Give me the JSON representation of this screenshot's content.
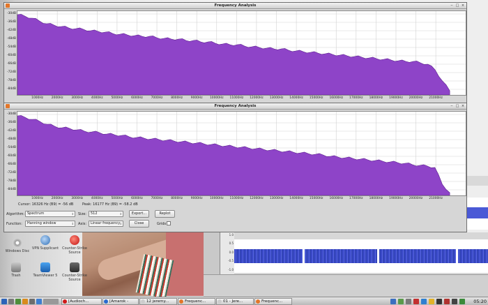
{
  "desktop": {
    "icons": [
      {
        "label": "Windows Disc",
        "icon": "disc-icon"
      },
      {
        "label": "VPN Supplicant",
        "icon": "globe-icon"
      },
      {
        "label": "Counter-Strike Source",
        "icon": "red-ball-icon"
      },
      {
        "label": "Trash",
        "icon": "trash-icon"
      },
      {
        "label": "TeamViewer 5",
        "icon": "teamviewer-icon"
      },
      {
        "label": "Counter-Strike Source",
        "icon": "cs-icon"
      }
    ]
  },
  "audio_editor": {
    "scale_labels": [
      "1.0",
      "0.5",
      "0.0",
      "-0.5",
      "-1.0"
    ]
  },
  "window_back": {
    "title": "Frequency Analysis",
    "y_ticks": [
      "-30dB",
      "-36dB",
      "-42dB",
      "-48dB",
      "-54dB",
      "-60dB",
      "-66dB",
      "-72dB",
      "-78dB",
      "-84dB"
    ],
    "x_ticks": [
      "1000Hz",
      "2000Hz",
      "3000Hz",
      "4000Hz",
      "5000Hz",
      "6000Hz",
      "7000Hz",
      "8000Hz",
      "9000Hz",
      "10000Hz",
      "11000Hz",
      "12000Hz",
      "13000Hz",
      "14000Hz",
      "15000Hz",
      "16000Hz",
      "17000Hz",
      "18000Hz",
      "19000Hz",
      "20000Hz",
      "21000Hz"
    ],
    "spectrum": [
      -30.5,
      -31.5,
      -33,
      -35,
      -37,
      -38,
      -39,
      -40,
      -40.5,
      -41,
      -42,
      -42.5,
      -43,
      -44,
      -44.5,
      -45,
      -45.5,
      -46,
      -46,
      -47,
      -47.5,
      -48,
      -48,
      -49,
      -49,
      -50,
      -50,
      -51,
      -51.5,
      -52,
      -52,
      -53,
      -53.5,
      -54,
      -54.5,
      -55,
      -55,
      -56,
      -56.5,
      -57,
      -57.5,
      -58,
      -58.5,
      -59,
      -59.5,
      -60,
      -60.5,
      -61,
      -61.5,
      -62,
      -62.5,
      -63,
      -63.5,
      -64,
      -64,
      -65,
      -66,
      -70,
      -78,
      -85
    ]
  },
  "window_front": {
    "title": "Frequency Analysis",
    "y_ticks": [
      "-30dB",
      "-36dB",
      "-42dB",
      "-48dB",
      "-54dB",
      "-60dB",
      "-66dB",
      "-72dB",
      "-78dB",
      "-84dB"
    ],
    "x_ticks": [
      "1000Hz",
      "2000Hz",
      "3000Hz",
      "4000Hz",
      "5000Hz",
      "6000Hz",
      "7000Hz",
      "8000Hz",
      "9000Hz",
      "10000Hz",
      "11000Hz",
      "12000Hz",
      "13000Hz",
      "14000Hz",
      "15000Hz",
      "16000Hz",
      "17000Hz",
      "18000Hz",
      "19000Hz",
      "20000Hz",
      "21000Hz"
    ],
    "spectrum": [
      -31,
      -32,
      -33.5,
      -35,
      -37,
      -38.5,
      -39.5,
      -40,
      -41,
      -42,
      -42.5,
      -43,
      -44,
      -44.5,
      -45,
      -46,
      -46.5,
      -47,
      -47.5,
      -48,
      -48.5,
      -49,
      -49.5,
      -50,
      -50.5,
      -51,
      -51.5,
      -52,
      -52.5,
      -53,
      -53.5,
      -54,
      -54.5,
      -55,
      -55.5,
      -56,
      -56.5,
      -57,
      -57.5,
      -58,
      -58.5,
      -59,
      -60,
      -60.5,
      -61,
      -61.5,
      -62,
      -62.5,
      -63,
      -63.5,
      -64,
      -64.5,
      -65,
      -66,
      -66.5,
      -67,
      -68,
      -80,
      -86
    ],
    "cursor_text": "Cursor: 16326 Hz (B9) = -56 dB",
    "peak_text": "Peak: 16177 Hz (B9) = -58.2 dB",
    "controls": {
      "algorithm_label": "Algorithm:",
      "algorithm_value": "Spectrum",
      "size_label": "Size:",
      "size_value": "512",
      "export_label": "Export...",
      "replot_label": "Replot",
      "function_label": "Function:",
      "function_value": "Hanning window",
      "axis_label": "Axis:",
      "axis_value": "Linear frequency",
      "close_label": "Close",
      "grids_label": "Grids"
    }
  },
  "taskbar": {
    "tasks": [
      {
        "label": "[Audioch...",
        "color": "#d01a1a"
      },
      {
        "label": "[Amarok -",
        "color": "#2a6ad0"
      },
      {
        "label": "12 jeremy...",
        "color": "#cccccc"
      },
      {
        "label": "Frequenc...",
        "color": "#e2762a"
      },
      {
        "label": "01 - Jere...",
        "color": "#cccccc"
      },
      {
        "label": "Frequenc...",
        "color": "#e2762a"
      }
    ],
    "clock": "05:20"
  },
  "colors": {
    "spectrum_fill": "#8e44c8",
    "spectrum_edge": "#5b1f8c",
    "grid": "#d2d2d2"
  }
}
